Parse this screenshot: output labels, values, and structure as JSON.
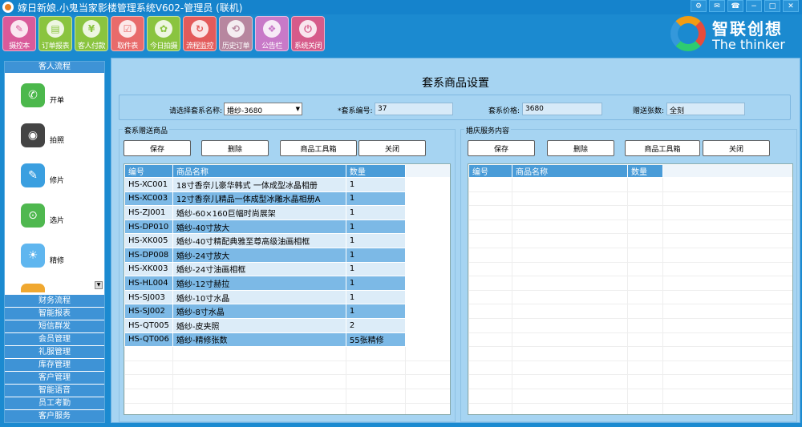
{
  "window": {
    "title": "嫁日新娘.小鬼当家影楼管理系统V602-管理员 (联机)"
  },
  "window_buttons": [
    "⚙",
    "✉",
    "☎",
    "−",
    "□",
    "✕"
  ],
  "toolbar": [
    {
      "label": "摄控本",
      "icon": "notebook-icon",
      "color": "#d95a9a"
    },
    {
      "label": "订单报表",
      "icon": "report-icon",
      "color": "#8ac43f"
    },
    {
      "label": "客人付款",
      "icon": "payment-icon",
      "color": "#8ac43f"
    },
    {
      "label": "取件表",
      "icon": "pickup-icon",
      "color": "#e86b6b"
    },
    {
      "label": "今日拍摄",
      "icon": "camera-icon",
      "color": "#8ac43f"
    },
    {
      "label": "流程监控",
      "icon": "monitor-icon",
      "color": "#e35b5b"
    },
    {
      "label": "历史订单",
      "icon": "history-icon",
      "color": "#b7869f"
    },
    {
      "label": "公告栏",
      "icon": "notice-icon",
      "color": "#c879c8"
    },
    {
      "label": "系统关闭",
      "icon": "power-icon",
      "color": "#d65b8a"
    }
  ],
  "logo": {
    "cn": "智联创想",
    "en": "The thinker"
  },
  "sidebar": {
    "header": "客人流程",
    "items": [
      {
        "label": "开单",
        "icon": "phone-icon",
        "color": "#4cb84c"
      },
      {
        "label": "拍照",
        "icon": "camera-lens-icon",
        "color": "#444444"
      },
      {
        "label": "修片",
        "icon": "edit-photo-icon",
        "color": "#3a9fe0"
      },
      {
        "label": "选片",
        "icon": "select-photo-icon",
        "color": "#4fb84f"
      },
      {
        "label": "精修",
        "icon": "weather-icon",
        "color": "#5fb6ef"
      }
    ],
    "bottom": [
      "财务流程",
      "智能报表",
      "短信群发",
      "会员管理",
      "礼服管理",
      "库存管理",
      "客户管理",
      "智能语音",
      "员工考勤",
      "客户服务"
    ]
  },
  "main": {
    "title": "套系商品设置",
    "form": {
      "package_label": "请选择套系名称:",
      "package_value": "婚纱-3680",
      "code_label": "*套系编号:",
      "code_value": "37",
      "price_label": "套系价格:",
      "price_value": "3680",
      "gift_label": "赠送张数:",
      "gift_value": "全刻"
    },
    "left_group": {
      "title": "套系赠送商品",
      "buttons": [
        "保存",
        "删除",
        "商品工具箱",
        "关闭"
      ],
      "columns": [
        "编号",
        "商品名称",
        "数量"
      ],
      "rows": [
        [
          "HS-XC001",
          "18寸香奈儿豪华韩式 一体成型冰晶相册",
          "1"
        ],
        [
          "HS-XC003",
          "12寸香奈儿精品一体成型冰雕水晶相册A",
          "1"
        ],
        [
          "HS-ZJ001",
          "婚纱-60×160巨幅时尚展架",
          "1"
        ],
        [
          "HS-DP010",
          "婚纱-40寸放大",
          "1"
        ],
        [
          "HS-XK005",
          "婚纱-40寸精配典雅至尊高级油画相框",
          "1"
        ],
        [
          "HS-DP008",
          "婚纱-24寸放大",
          "1"
        ],
        [
          "HS-XK003",
          "婚纱-24寸油画相框",
          "1"
        ],
        [
          "HS-HL004",
          "婚纱-12寸赫拉",
          "1"
        ],
        [
          "HS-SJ003",
          "婚纱-10寸水晶",
          "1"
        ],
        [
          "HS-SJ002",
          "婚纱-8寸水晶",
          "1"
        ],
        [
          "HS-QT005",
          "婚纱-皮夹照",
          "2"
        ],
        [
          "HS-QT006",
          "婚纱-精修张数",
          "55张精修"
        ]
      ]
    },
    "right_group": {
      "title": "婚庆服务内容",
      "buttons": [
        "保存",
        "删除",
        "商品工具箱",
        "关闭"
      ],
      "columns": [
        "编号",
        "商品名称",
        "数量"
      ]
    }
  }
}
